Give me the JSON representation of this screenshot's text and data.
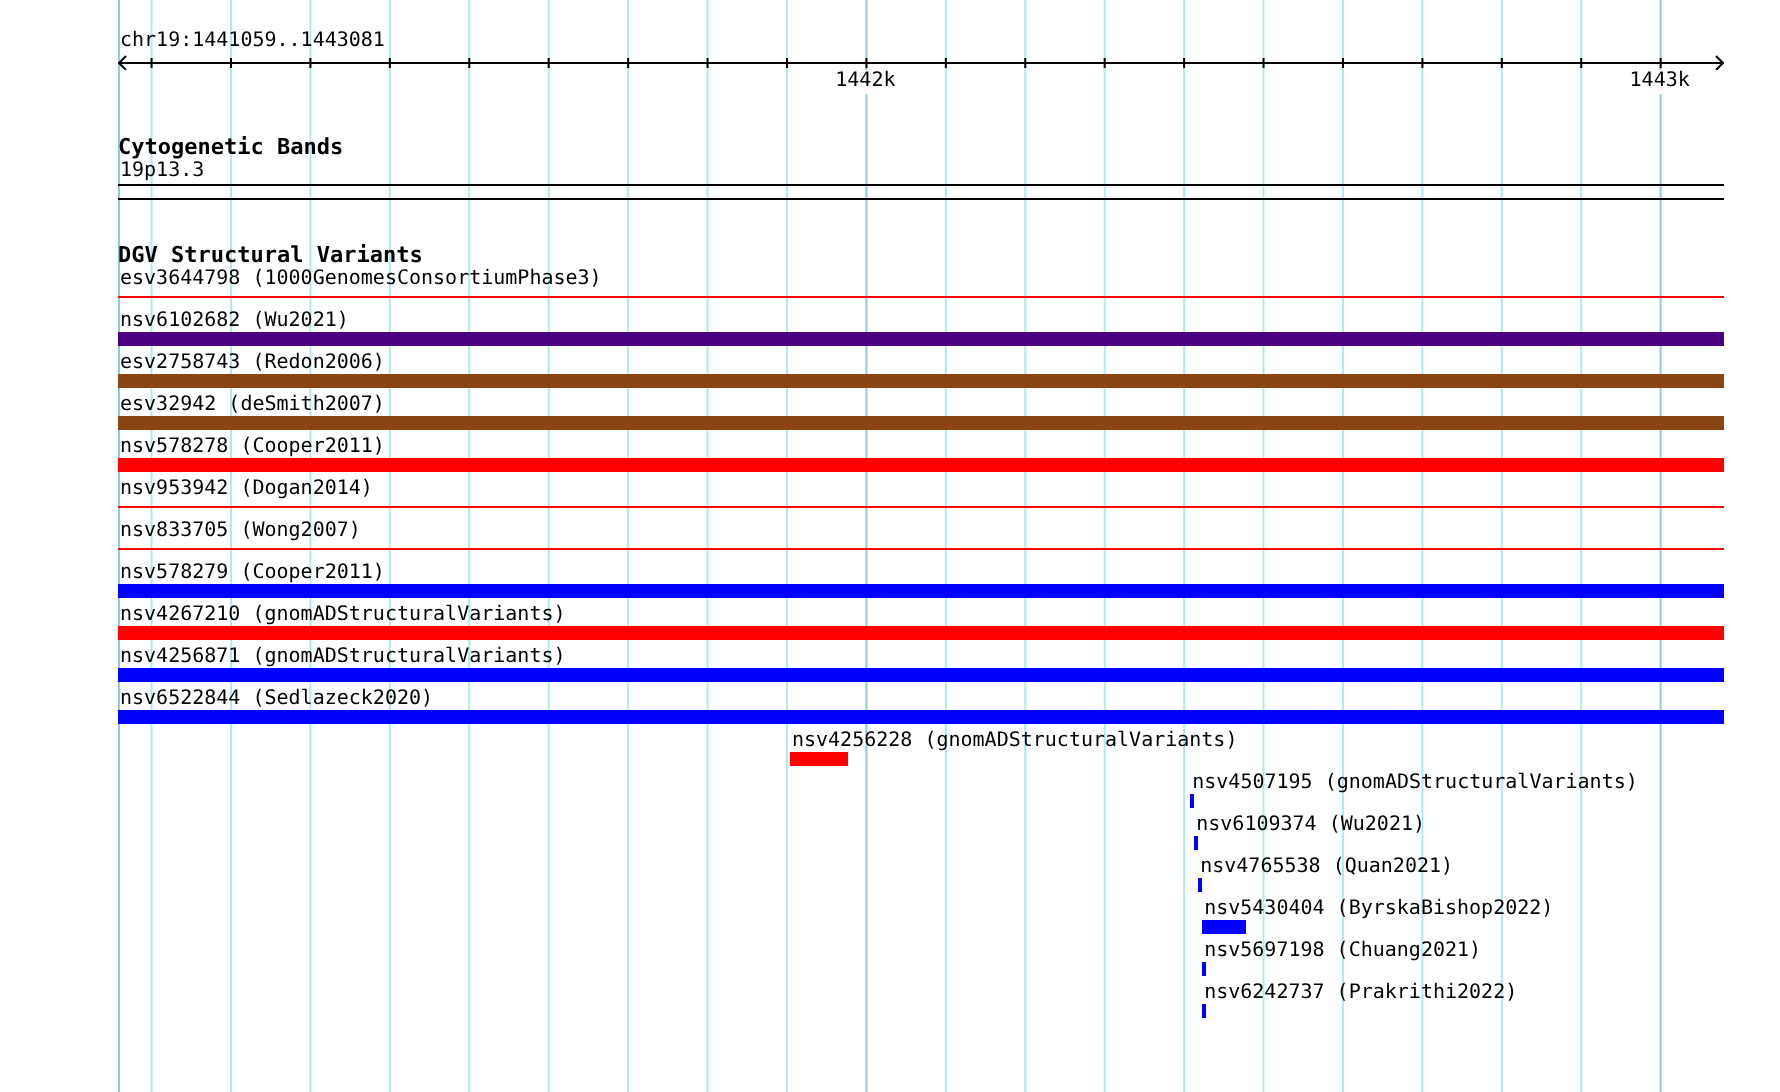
{
  "ruler": {
    "location": "chr19:1441059..1443081",
    "tick_labels": [
      "1442k",
      "1443k"
    ]
  },
  "cytogenetic_bands": {
    "title": "Cytogenetic Bands",
    "band_label": "19p13.3"
  },
  "structural_variants": {
    "title": "DGV Structural Variants",
    "features": [
      {
        "label": "esv3644798 (1000GenomesConsortiumPhase3)",
        "color": "#ff0000",
        "kind": "line"
      },
      {
        "label": "nsv6102682 (Wu2021)",
        "color": "#4b0082",
        "kind": "bar"
      },
      {
        "label": "esv2758743 (Redon2006)",
        "color": "#8b4513",
        "kind": "bar"
      },
      {
        "label": "esv32942 (deSmith2007)",
        "color": "#8b4513",
        "kind": "bar"
      },
      {
        "label": "nsv578278 (Cooper2011)",
        "color": "#ff0000",
        "kind": "bar"
      },
      {
        "label": "nsv953942 (Dogan2014)",
        "color": "#ff0000",
        "kind": "line"
      },
      {
        "label": "nsv833705 (Wong2007)",
        "color": "#ff0000",
        "kind": "line"
      },
      {
        "label": "nsv578279 (Cooper2011)",
        "color": "#0000ff",
        "kind": "bar"
      },
      {
        "label": "nsv4267210 (gnomADStructuralVariants)",
        "color": "#ff0000",
        "kind": "bar"
      },
      {
        "label": "nsv4256871 (gnomADStructuralVariants)",
        "color": "#0000ff",
        "kind": "bar"
      },
      {
        "label": "nsv6522844 (Sedlazeck2020)",
        "color": "#0000ff",
        "kind": "bar"
      },
      {
        "label": "nsv4256228 (gnomADStructuralVariants)",
        "color": "#ff0000",
        "kind": "bar"
      },
      {
        "label": "nsv4507195 (gnomADStructuralVariants)",
        "color": "#0000ff",
        "kind": "bar"
      },
      {
        "label": "nsv6109374 (Wu2021)",
        "color": "#0000ff",
        "kind": "bar"
      },
      {
        "label": "nsv4765538 (Quan2021)",
        "color": "#0000ff",
        "kind": "bar"
      },
      {
        "label": "nsv5430404 (ByrskaBishop2022)",
        "color": "#0000ff",
        "kind": "bar"
      },
      {
        "label": "nsv5697198 (Chuang2021)",
        "color": "#0000ff",
        "kind": "bar"
      },
      {
        "label": "nsv6242737 (Prakrithi2022)",
        "color": "#0000ff",
        "kind": "bar"
      }
    ]
  }
}
